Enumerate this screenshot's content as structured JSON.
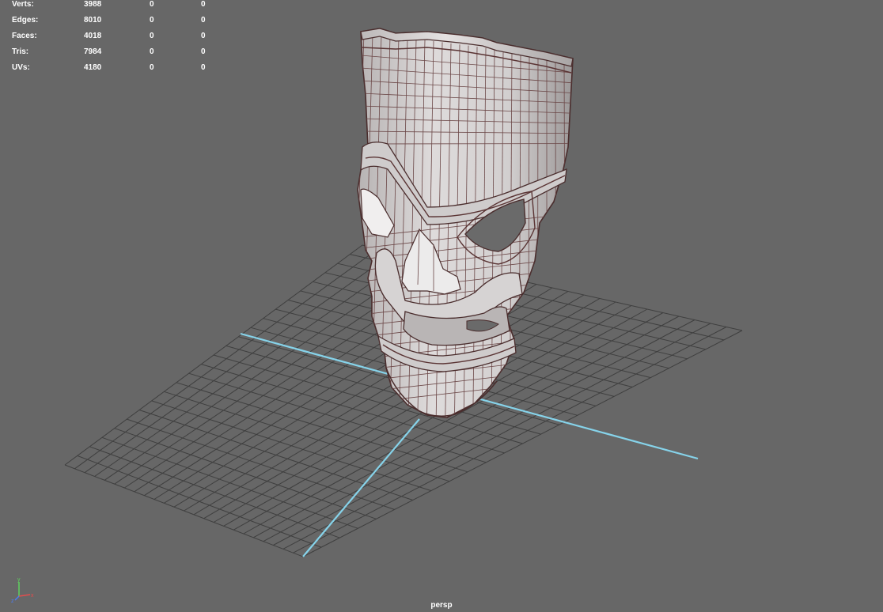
{
  "hud": {
    "rows": [
      {
        "label": "Verts:",
        "v1": "3988",
        "v2": "0",
        "v3": "0"
      },
      {
        "label": "Edges:",
        "v1": "8010",
        "v2": "0",
        "v3": "0"
      },
      {
        "label": "Faces:",
        "v1": "4018",
        "v2": "0",
        "v3": "0"
      },
      {
        "label": "Tris:",
        "v1": "7984",
        "v2": "0",
        "v3": "0"
      },
      {
        "label": "UVs:",
        "v1": "4180",
        "v2": "0",
        "v3": "0"
      }
    ]
  },
  "camera": {
    "name": "persp"
  },
  "axis_gizmo": {
    "x_label": "x",
    "y_label": "y",
    "z_label": "z"
  },
  "colors": {
    "background": "#676767",
    "grid_line": "#3c3c3c",
    "grid_axis": "#7ecfe8",
    "mesh_fill": "#d9d6d6",
    "mesh_shade": "#a9a5a5",
    "wire": "#5a3a3a"
  },
  "scene": {
    "object": "tiki-mask-mesh",
    "display": "wireframe-on-shaded"
  }
}
